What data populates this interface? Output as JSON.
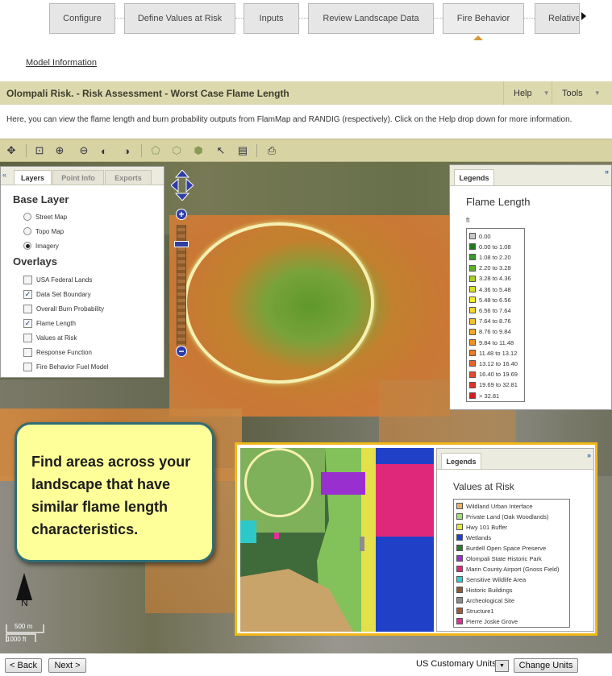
{
  "wizard": {
    "tabs": [
      "Configure",
      "Define Values at Risk",
      "Inputs",
      "Review Landscape Data",
      "Fire Behavior",
      "Relative"
    ]
  },
  "model_info": "Model Information",
  "header": {
    "title": "Olompali Risk. - Risk Assessment - Worst Case Flame Length",
    "help": "Help",
    "tools": "Tools"
  },
  "description": "Here, you can view the flame length and burn probability outputs from FlamMap and RANDIG (respectively). Click on the Help drop down for more information.",
  "layers_panel": {
    "tabs": [
      "Layers",
      "Point Info",
      "Exports"
    ],
    "base_heading": "Base Layer",
    "base_options": [
      {
        "label": "Street Map",
        "selected": false
      },
      {
        "label": "Topo Map",
        "selected": false
      },
      {
        "label": "Imagery",
        "selected": true
      }
    ],
    "overlay_heading": "Overlays",
    "overlays": [
      {
        "label": "USA Federal Lands",
        "checked": false
      },
      {
        "label": "Data Set Boundary",
        "checked": true
      },
      {
        "label": "Overall Burn Probability",
        "checked": false
      },
      {
        "label": "Flame Length",
        "checked": true
      },
      {
        "label": "Values at Risk",
        "checked": false
      },
      {
        "label": "Response Function",
        "checked": false
      },
      {
        "label": "Fire Behavior Fuel Model",
        "checked": false
      }
    ]
  },
  "flame_legend": {
    "tab": "Legends",
    "title": "Flame Length",
    "unit": "ft",
    "items": [
      {
        "label": "0.00",
        "color": "#c8c8c8"
      },
      {
        "label": "0.00 to 1.08",
        "color": "#1f7a1f"
      },
      {
        "label": "1.08 to 2.20",
        "color": "#3a9b2a"
      },
      {
        "label": "2.20 to 3.28",
        "color": "#5fb02a"
      },
      {
        "label": "3.28 to 4.36",
        "color": "#a8cf2a"
      },
      {
        "label": "4.36 to 5.48",
        "color": "#d8e02a"
      },
      {
        "label": "5.48 to 6.56",
        "color": "#f5ef2a"
      },
      {
        "label": "6.56 to 7.64",
        "color": "#f7d82a"
      },
      {
        "label": "7.64 to 8.76",
        "color": "#f5c02a"
      },
      {
        "label": "8.76 to 9.84",
        "color": "#f2a82a"
      },
      {
        "label": "9.84 to 11.48",
        "color": "#ef922a"
      },
      {
        "label": "11.48 to 13.12",
        "color": "#ec7a2a"
      },
      {
        "label": "13.12 to 16.40",
        "color": "#e8632a"
      },
      {
        "label": "16.40 to 19.69",
        "color": "#e44b2a"
      },
      {
        "label": "19.69 to 32.81",
        "color": "#df322a"
      },
      {
        "label": "> 32.81",
        "color": "#d81a1a"
      }
    ]
  },
  "callout": "Find areas across your landscape that have similar flame length characteristics.",
  "values_legend": {
    "tab": "Legends",
    "title": "Values at Risk",
    "items": [
      {
        "label": "Wildland Urban Interface",
        "color": "#e9b36b"
      },
      {
        "label": "Private Land (Oak Woodlands)",
        "color": "#9fe07a"
      },
      {
        "label": "Hwy 101 Buffer",
        "color": "#e8e83a"
      },
      {
        "label": "Wetlands",
        "color": "#1f3fd0"
      },
      {
        "label": "Burdell Open Space Preserve",
        "color": "#2f7a2f"
      },
      {
        "label": "Olompali State Historic Park",
        "color": "#9a2fcf"
      },
      {
        "label": "Marin County Airport (Gnoss Field)",
        "color": "#e0287a"
      },
      {
        "label": "Sensitive Wildlife Area",
        "color": "#2fd0d0"
      },
      {
        "label": "Historic Buildings",
        "color": "#8b5a3a"
      },
      {
        "label": "Archeological Site",
        "color": "#8c8c8c"
      },
      {
        "label": "Structure1",
        "color": "#a05a3a"
      },
      {
        "label": "Pierre Joske Grove",
        "color": "#e02f9a"
      }
    ]
  },
  "north_label": "N",
  "scale": {
    "top": "500 m",
    "bottom": "1000 ft"
  },
  "footer": {
    "back": "< Back",
    "next": "Next >",
    "units": "US Customary Units",
    "change_units": "Change Units"
  }
}
